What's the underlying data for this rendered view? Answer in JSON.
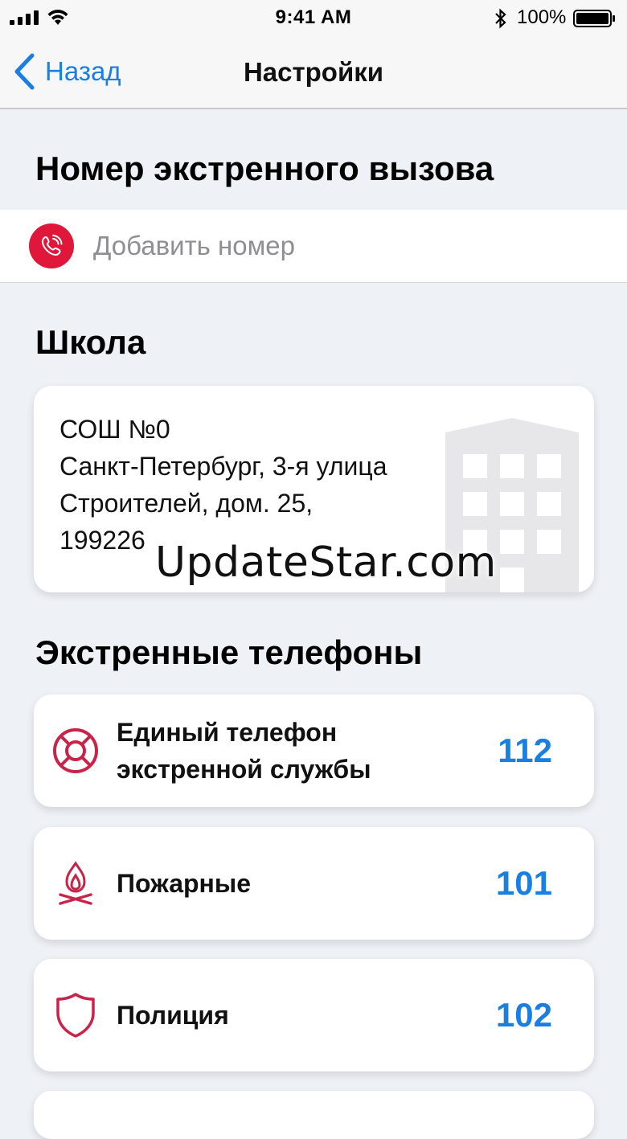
{
  "status_bar": {
    "time": "9:41 AM",
    "battery": "100%"
  },
  "nav": {
    "back_label": "Назад",
    "title": "Настройки"
  },
  "emergency_number": {
    "title": "Номер экстренного вызова",
    "add_label": "Добавить номер",
    "icon": "phone-icon"
  },
  "school": {
    "title": "Школа",
    "lines": [
      "СОШ №0",
      "Санкт-Петербург, 3-я улица",
      "Строителей, дом. 25,",
      "199226"
    ],
    "icon": "building-icon"
  },
  "watermark": "UpdateStar.com",
  "emergency_phones": {
    "title": "Экстренные телефоны",
    "items": [
      {
        "name": "Единый телефон экстренной службы",
        "number": "112",
        "icon": "lifebuoy-icon"
      },
      {
        "name": "Пожарные",
        "number": "101",
        "icon": "fire-icon"
      },
      {
        "name": "Полиция",
        "number": "102",
        "icon": "shield-icon"
      }
    ]
  },
  "colors": {
    "accent": "#1a7fe0",
    "danger": "#e1163b",
    "icon_red": "#c8244a"
  }
}
